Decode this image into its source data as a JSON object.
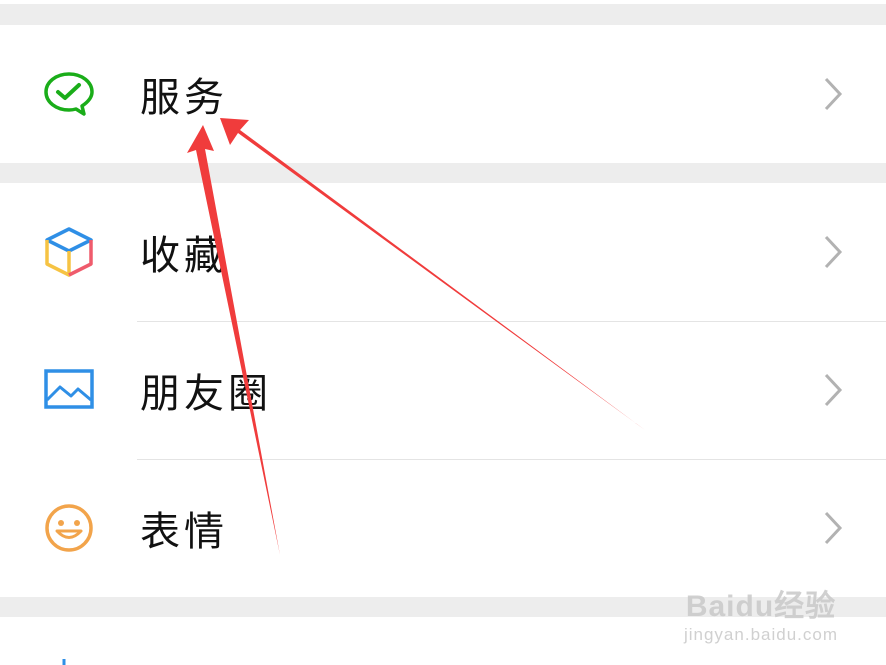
{
  "menu": {
    "items": [
      {
        "label": "服务",
        "icon": "wechat-pay-icon"
      },
      {
        "label": "收藏",
        "icon": "favorites-cube-icon"
      },
      {
        "label": "朋友圈",
        "icon": "moments-picture-icon"
      },
      {
        "label": "表情",
        "icon": "emoji-smile-icon"
      }
    ]
  },
  "colors": {
    "page_bg": "#ededed",
    "row_bg": "#ffffff",
    "text": "#111111",
    "chevron": "#b2b2b2",
    "wechat_green": "#1aad19",
    "annotation_red": "#f03c3c"
  },
  "watermark": {
    "main": "Baidu经验",
    "sub": "jingyan.baidu.com"
  }
}
